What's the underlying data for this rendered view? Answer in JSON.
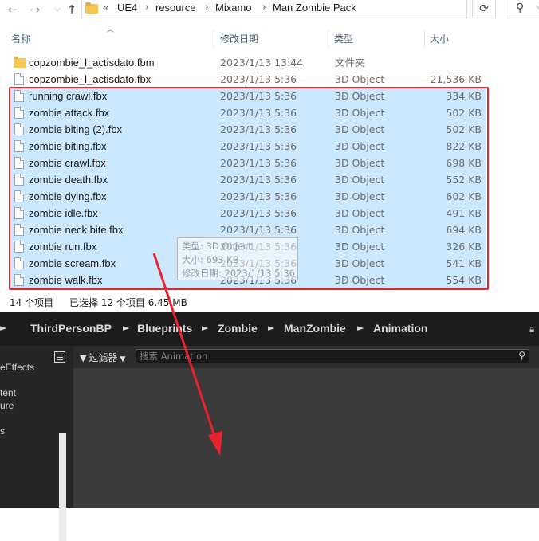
{
  "address": {
    "overflow": "«",
    "crumbs": [
      "UE4",
      "resource",
      "Mixamo",
      "Man Zombie Pack"
    ],
    "search_icon": "search-icon",
    "refresh_icon": "refresh-icon"
  },
  "columns": {
    "name": "名称",
    "date": "修改日期",
    "type": "类型",
    "size": "大小"
  },
  "files": [
    {
      "name": "copzombie_l_actisdato.fbm",
      "date": "2023/1/13 13:44",
      "type": "文件夹",
      "size": "",
      "kind": "folder",
      "selected": false
    },
    {
      "name": "copzombie_l_actisdato.fbx",
      "date": "2023/1/13 5:36",
      "type": "3D Object",
      "size": "21,536 KB",
      "kind": "file",
      "selected": false
    },
    {
      "name": "running crawl.fbx",
      "date": "2023/1/13 5:36",
      "type": "3D Object",
      "size": "334 KB",
      "kind": "file",
      "selected": true
    },
    {
      "name": "zombie attack.fbx",
      "date": "2023/1/13 5:36",
      "type": "3D Object",
      "size": "502 KB",
      "kind": "file",
      "selected": true
    },
    {
      "name": "zombie biting (2).fbx",
      "date": "2023/1/13 5:36",
      "type": "3D Object",
      "size": "502 KB",
      "kind": "file",
      "selected": true
    },
    {
      "name": "zombie biting.fbx",
      "date": "2023/1/13 5:36",
      "type": "3D Object",
      "size": "822 KB",
      "kind": "file",
      "selected": true
    },
    {
      "name": "zombie crawl.fbx",
      "date": "2023/1/13 5:36",
      "type": "3D Object",
      "size": "698 KB",
      "kind": "file",
      "selected": true
    },
    {
      "name": "zombie death.fbx",
      "date": "2023/1/13 5:36",
      "type": "3D Object",
      "size": "552 KB",
      "kind": "file",
      "selected": true
    },
    {
      "name": "zombie dying.fbx",
      "date": "2023/1/13 5:36",
      "type": "3D Object",
      "size": "602 KB",
      "kind": "file",
      "selected": true
    },
    {
      "name": "zombie idle.fbx",
      "date": "2023/1/13 5:36",
      "type": "3D Object",
      "size": "491 KB",
      "kind": "file",
      "selected": true
    },
    {
      "name": "zombie neck bite.fbx",
      "date": "2023/1/13 5:36",
      "type": "3D Object",
      "size": "694 KB",
      "kind": "file",
      "selected": true
    },
    {
      "name": "zombie run.fbx",
      "date": "2023/1/13 5:36",
      "type": "3D Object",
      "size": "326 KB",
      "kind": "file",
      "selected": true
    },
    {
      "name": "zombie scream.fbx",
      "date": "2023/1/13 5:36",
      "type": "3D Object",
      "size": "541 KB",
      "kind": "file",
      "selected": true
    },
    {
      "name": "zombie walk.fbx",
      "date": "2023/1/13 5:36",
      "type": "3D Object",
      "size": "554 KB",
      "kind": "file",
      "selected": true
    }
  ],
  "tooltip": {
    "type_line": "类型: 3D Object",
    "size_line": "大小: 693 KB",
    "date_line": "修改日期: 2023/1/13 5:36"
  },
  "status": {
    "count": "14 个项目",
    "selected": "已选择 12 个项目  6.45 MB"
  },
  "unreal": {
    "crumbs": [
      "ThirdPersonBP",
      "Blueprints",
      "Zombie",
      "ManZombie",
      "Animation"
    ],
    "tree": [
      "eEffects",
      "tent",
      "ure",
      "s"
    ],
    "filter_label": "过滤器",
    "search_placeholder": "搜索 Animation"
  },
  "colors": {
    "selection": "#cce8ff",
    "highlight_box": "#e8232e",
    "arrow": "#e8232e"
  }
}
